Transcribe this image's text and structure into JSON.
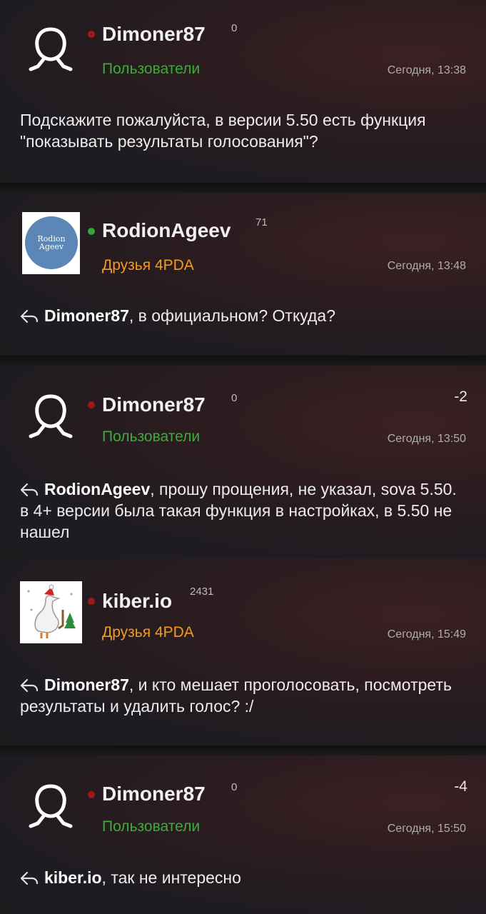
{
  "posts": [
    {
      "username": "Dimoner87",
      "reputation": "0",
      "group": "Пользователи",
      "time": "Сегодня, 13:38",
      "text": "Подскажите пожалуйста, в версии 5.50 есть функция \"показывать результаты голосования\"?",
      "status": "offline"
    },
    {
      "username": "RodionAgeev",
      "reputation": "71",
      "group": "Друзья 4PDA",
      "time": "Сегодня, 13:48",
      "avatar_text": [
        "Rodion",
        "Ageev"
      ],
      "avatar_color": "#5b86b5",
      "reply_to": "Dimoner87",
      "text": ", в официальном? Откуда?",
      "status": "online"
    },
    {
      "username": "Dimoner87",
      "reputation": "0",
      "group": "Пользователи",
      "time": "Сегодня, 13:50",
      "rating": "-2",
      "reply_to": "RodionAgeev",
      "text": ", прошу прощения, не указал, sova 5.50. в 4+ версии была такая функция в настройках, в 5.50 не нашел",
      "status": "offline"
    },
    {
      "username": "kiber.io",
      "reputation": "2431",
      "group": "Друзья 4PDA",
      "time": "Сегодня, 15:49",
      "reply_to": "Dimoner87",
      "text": ", и кто мешает проголосовать, посмотреть результаты и удалить голос? :/",
      "status": "offline"
    },
    {
      "username": "Dimoner87",
      "reputation": "0",
      "group": "Пользователи",
      "time": "Сегодня, 15:50",
      "rating": "-4",
      "reply_to": "kiber.io",
      "text": ", так не интересно",
      "status": "offline"
    }
  ],
  "colors": {
    "group_users": "#3faa3a",
    "group_friends": "#f39b1f",
    "status_offline": "#9e1a1a",
    "status_online": "#36a637"
  },
  "icons": {
    "default_avatar": "person-outline-icon",
    "reply": "reply-arrow-icon"
  }
}
